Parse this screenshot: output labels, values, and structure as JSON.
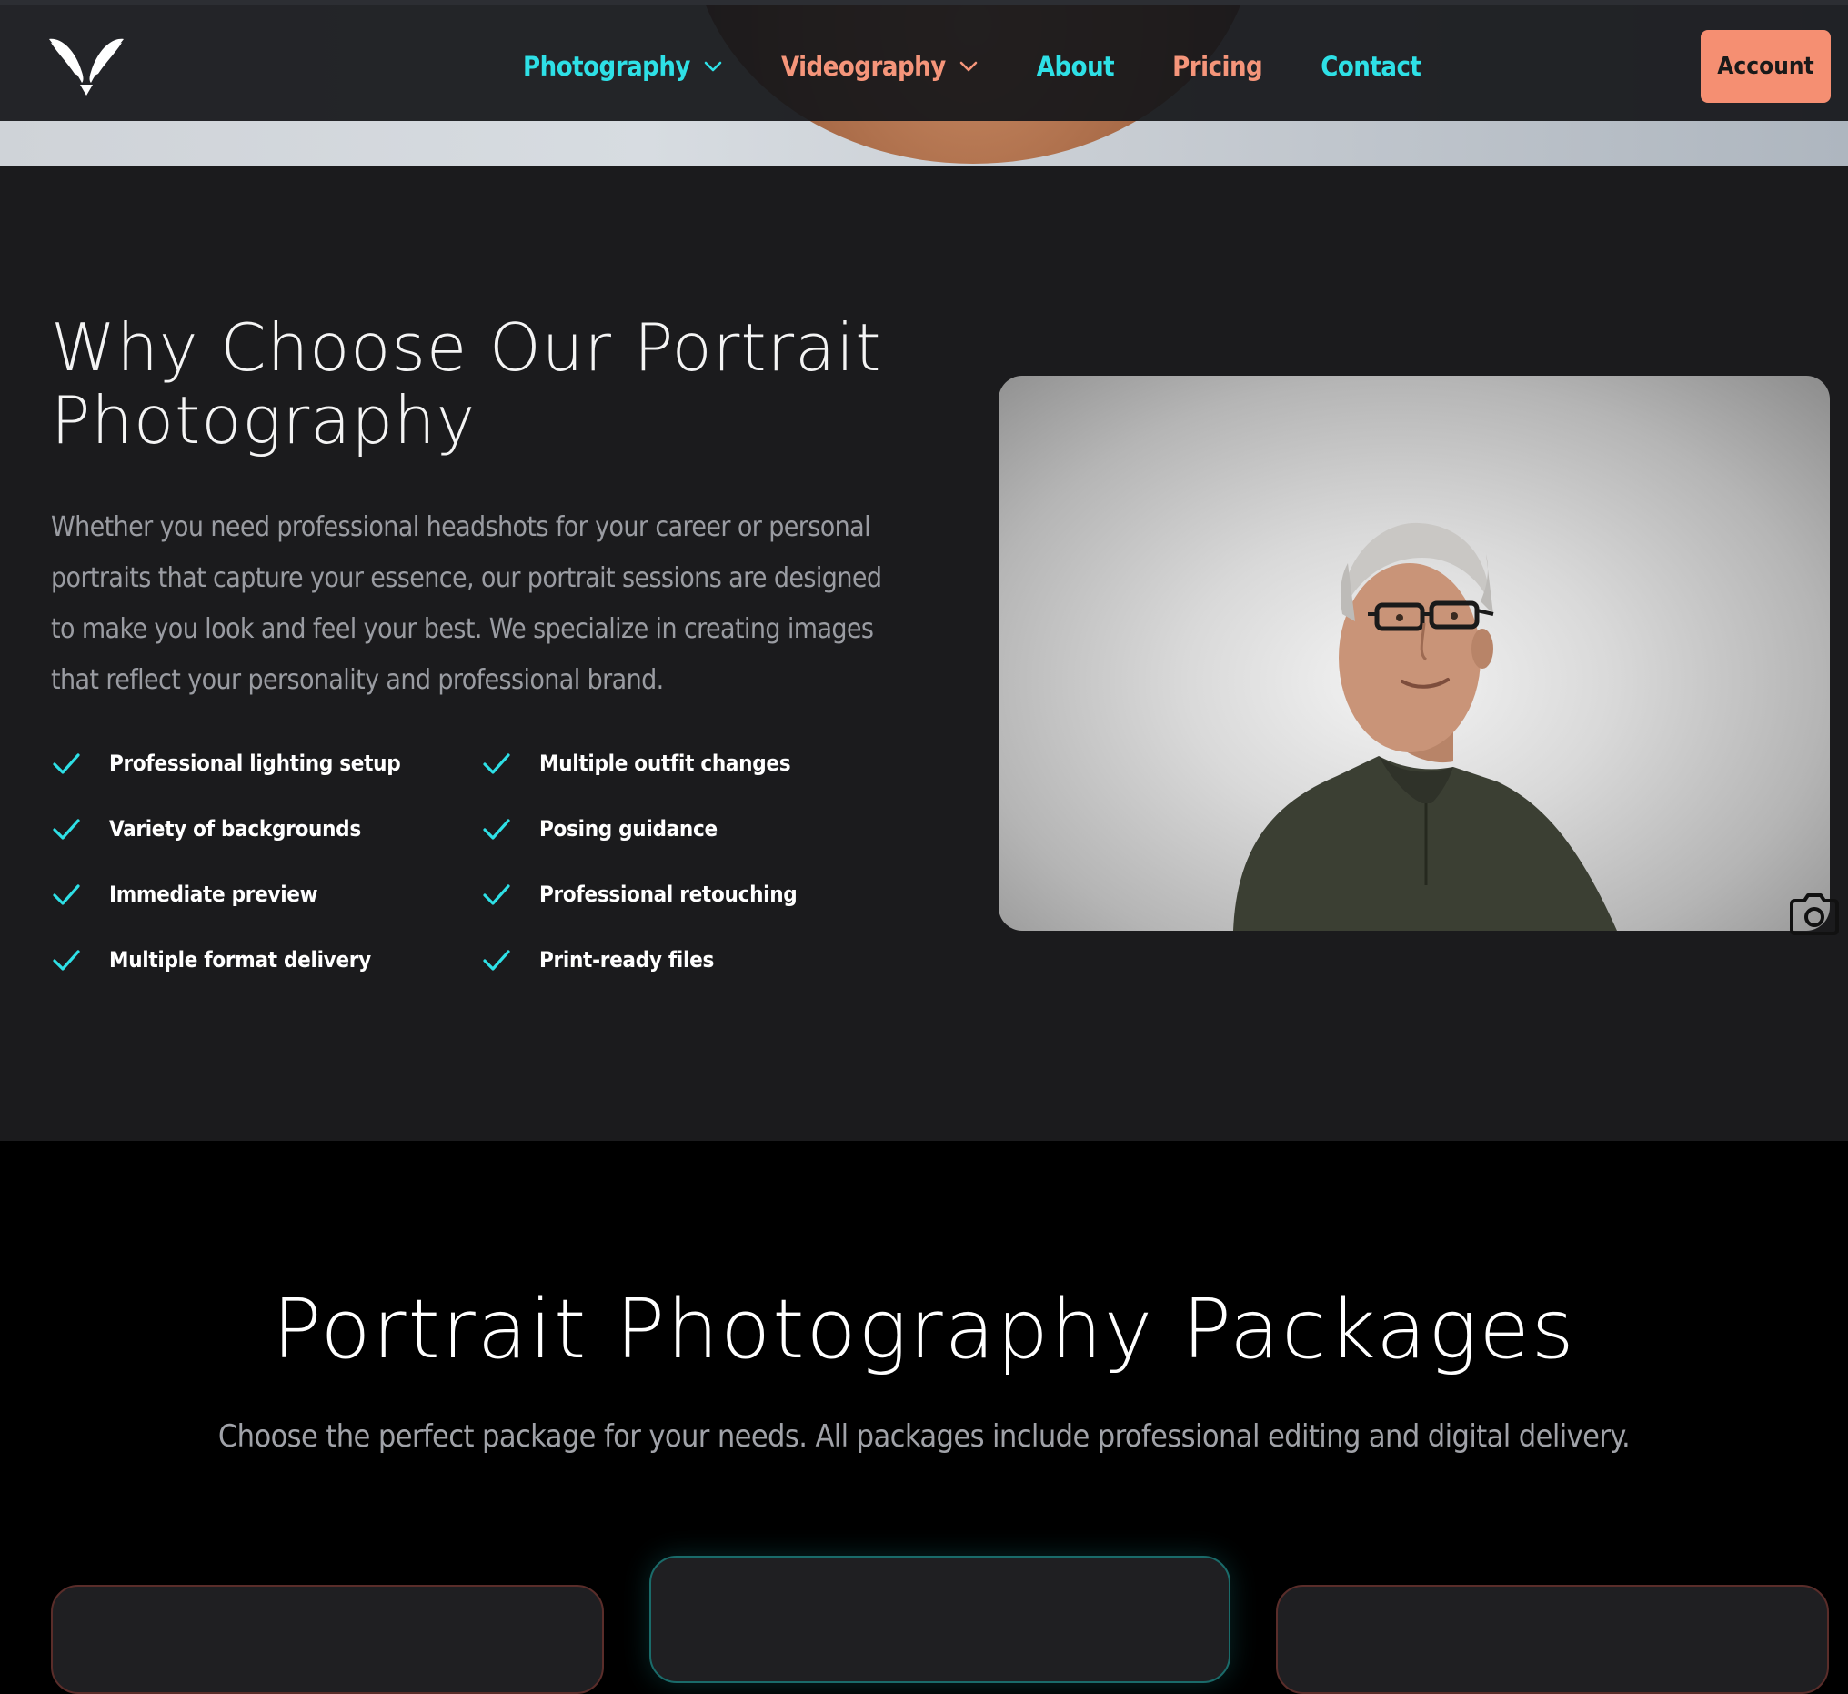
{
  "header": {
    "logo_icon": "winged-v-logo-icon",
    "nav": [
      {
        "label": "Photography",
        "color": "#2ee0e6",
        "has_dropdown": true
      },
      {
        "label": "Videography",
        "color": "#f5957a",
        "has_dropdown": true
      },
      {
        "label": "About",
        "color": "#2ee0e6",
        "has_dropdown": false
      },
      {
        "label": "Pricing",
        "color": "#f5957a",
        "has_dropdown": false
      },
      {
        "label": "Contact",
        "color": "#2ee0e6",
        "has_dropdown": false
      }
    ],
    "account_label": "Account",
    "account_color": "#f58f72"
  },
  "why": {
    "title": "Why Choose Our Portrait Photography",
    "body": "Whether you need professional headshots for your career or personal portraits that capture your essence, our portrait sessions are designed to make you look and feel your best. We specialize in creating images that reflect your personality and professional brand.",
    "features": [
      "Professional lighting setup",
      "Multiple outfit changes",
      "Variety of backgrounds",
      "Posing guidance",
      "Immediate preview",
      "Professional retouching",
      "Multiple format delivery",
      "Print-ready files"
    ],
    "check_icon": "checkmark-icon",
    "check_color": "#2ee0e6",
    "image_icon": "camera-icon"
  },
  "packages": {
    "title": "Portrait Photography Packages",
    "subtitle": "Choose the perfect package for your needs. All packages include professional editing and digital delivery."
  }
}
